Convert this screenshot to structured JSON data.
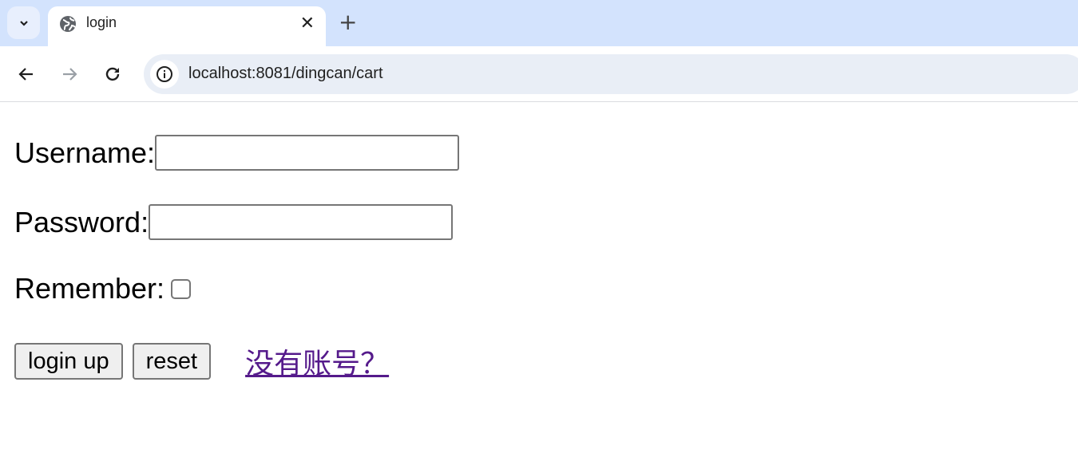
{
  "browser": {
    "tab_title": "login",
    "url": "localhost:8081/dingcan/cart"
  },
  "form": {
    "username_label": "Username:",
    "username_value": "",
    "password_label": "Password:",
    "password_value": "",
    "remember_label": "Remember:",
    "remember_checked": false,
    "login_button": "login up",
    "reset_button": "reset",
    "register_link": "没有账号？ "
  }
}
